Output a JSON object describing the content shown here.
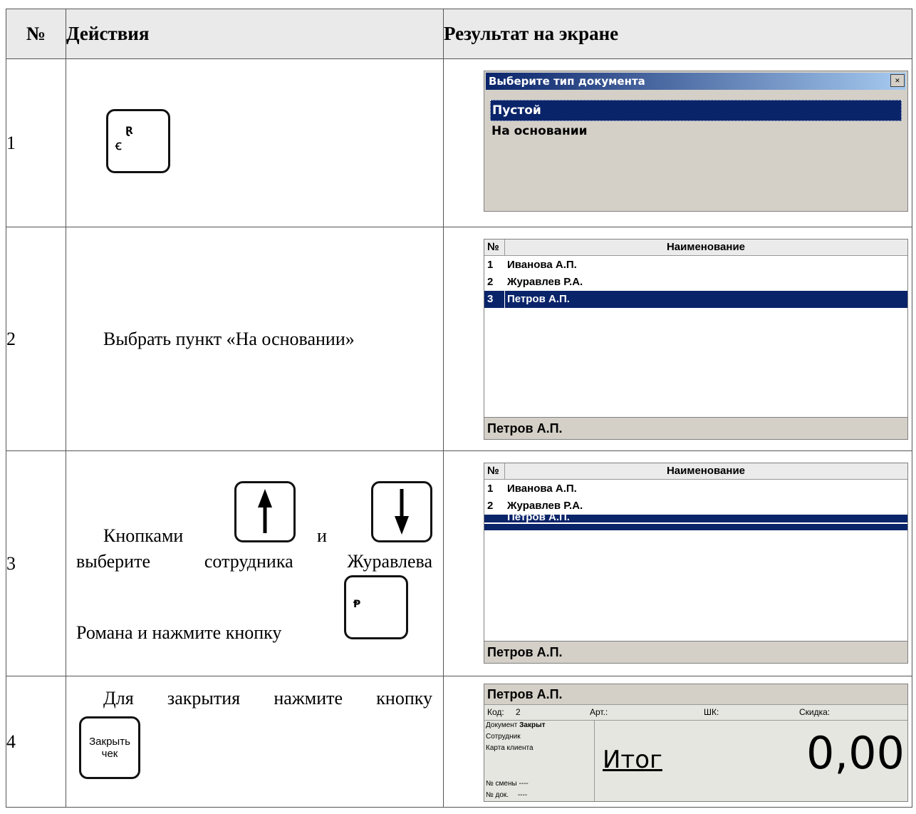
{
  "header": {
    "num": "№",
    "actions": "Действия",
    "result": "Результат на экране"
  },
  "rows": [
    {
      "num": "1",
      "key_glyph": "ʙ\nᵄ",
      "dialog": {
        "title": "Выберите тип документа",
        "close": "×",
        "options": [
          "Пустой",
          "На основании"
        ],
        "selected": "Пустой"
      }
    },
    {
      "num": "2",
      "action": "Выбрать пункт «На основании»",
      "list": {
        "col_num": "№",
        "col_name": "Наименование",
        "items": [
          {
            "n": "1",
            "name": "Иванова А.П."
          },
          {
            "n": "2",
            "name": "Журавлев Р.А."
          },
          {
            "n": "3",
            "name": "Петров А.П."
          }
        ],
        "selected": "Петров А.П.",
        "footer": "Петров А.П."
      }
    },
    {
      "num": "3",
      "action_part1": "Кнопками",
      "action_and": "и",
      "action_part2": "выберите сотрудника Журавлева",
      "action_part3": "Романа и нажмите кнопку",
      "list": {
        "col_num": "№",
        "col_name": "Наименование",
        "items": [
          {
            "n": "1",
            "name": "Иванова А.П."
          },
          {
            "n": "2",
            "name": "Журавлев Р.А."
          },
          {
            "n": "",
            "name": "Петров А.П."
          }
        ],
        "footer": "Петров А.П."
      }
    },
    {
      "num": "4",
      "action": "Для закрытия нажмите кнопку",
      "key_label": "Закрыть чек",
      "receipt": {
        "employee": "Петров А.П.",
        "code_label": "Код:",
        "code_value": "2",
        "art_label": "Арт.:",
        "barcode_label": "ШК:",
        "discount_label": "Скидка:",
        "doc_label": "Документ",
        "doc_status": "Закрыт",
        "employee_label": "Сотрудник",
        "card_label": "Карта клиента",
        "shift_label": "№ смены",
        "shift_value": "----",
        "docnum_label": "№ док.",
        "docnum_value": "----",
        "total_label": "Итог",
        "total_value": "0,00"
      }
    }
  ]
}
